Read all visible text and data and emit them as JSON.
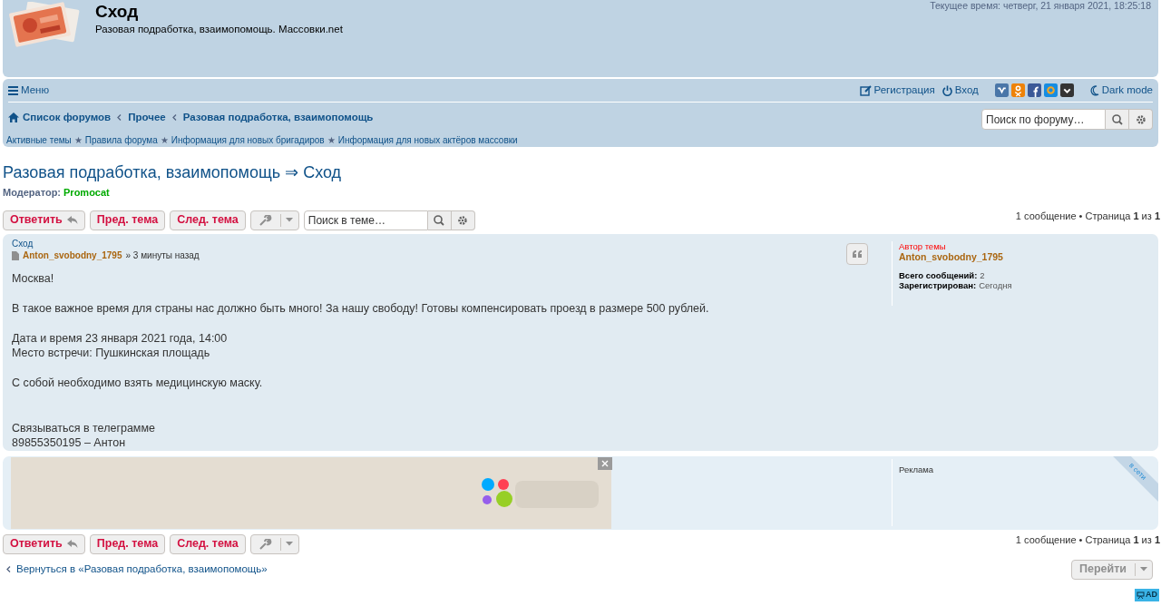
{
  "header": {
    "title": "Сход",
    "subtitle": "Разовая подработка, взаимопомощь. Массовки.net",
    "current_time": "Текущее время: четверг, 21 января 2021, 18:25:18"
  },
  "navbar": {
    "menu": "Меню",
    "register": "Регистрация",
    "login": "Вход",
    "social": [
      {
        "kind": "vk",
        "color": "#4a76a8"
      },
      {
        "kind": "ok",
        "color": "#ee8208"
      },
      {
        "kind": "fb",
        "color": "#3b5998"
      },
      {
        "kind": "mail",
        "color": "#168de2"
      },
      {
        "kind": "pocket",
        "color": "#333333"
      }
    ],
    "dark_mode": "Dark mode"
  },
  "breadcrumbs": [
    "Список форумов",
    "Прочее",
    "Разовая подработка, взаимопомощь"
  ],
  "forum_search": {
    "placeholder": "Поиск по форуму…"
  },
  "quick_links": [
    "Активные темы",
    "Правила форума",
    "Информация для новых бригадиров",
    "Информация для новых актёров массовки"
  ],
  "quick_link_separators": [
    "★",
    "★",
    "★"
  ],
  "topic": {
    "title": "Разовая подработка, взаимопомощь ⇒ Сход",
    "moderator_label": "Модератор:",
    "moderator": "Promocat"
  },
  "actions": {
    "reply": "Ответить",
    "prev": "Пред. тема",
    "next": "След. тема",
    "search_placeholder": "Поиск в теме…"
  },
  "pagination": "1 сообщение • Страница **1** из **1**",
  "post": {
    "subject": "Сход",
    "author": "Anton_svobodny_1795",
    "time": "» 3 минуты назад",
    "paragraphs": [
      [
        "Москва!"
      ],
      [
        "В такое важное время для страны нас должно быть много! За нашу свободу! Готовы компенсировать проезд в размере 500 рублей."
      ],
      [
        "Дата и время 23 января 2021 года, 14:00",
        "Место встречи: Пушкинская площадь"
      ],
      [
        "С собой необходимо взять медицинскую маску."
      ],
      [
        "Связываться в телеграмме",
        "89855350195 – Антон"
      ]
    ]
  },
  "profile": {
    "role": "Автор темы",
    "name": "Anton_svobodny_1795",
    "stats": [
      {
        "label": "Всего сообщений:",
        "value": "2"
      },
      {
        "label": "Зарегистрирован:",
        "value": "Сегодня"
      }
    ]
  },
  "ad": {
    "label": "Реклама",
    "ribbon": "в сети"
  },
  "bottom_actions": {
    "reply": "Ответить",
    "prev": "Пред. тема",
    "next": "След. тема"
  },
  "bottom_pagination": "1 сообщение • Страница **1** из **1**",
  "back_link": "Вернуться в «Разовая подработка, взаимопомощь»",
  "jump": "Перейти",
  "corner_badge": "AD"
}
